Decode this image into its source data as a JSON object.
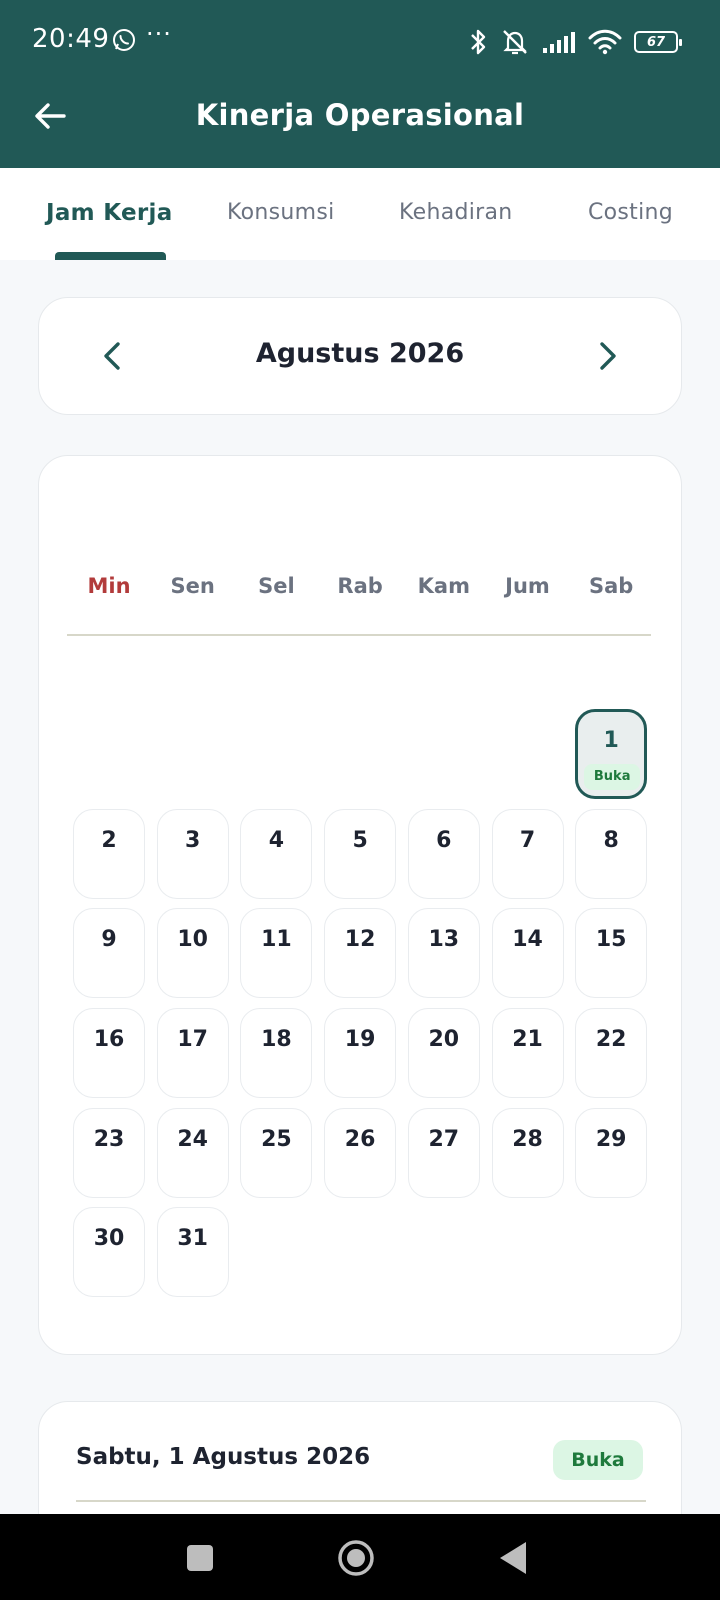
{
  "status_bar": {
    "time": "20:49",
    "more": "···",
    "battery": "67",
    "icons": [
      "whatsapp-icon",
      "bluetooth-icon",
      "alarm-off-icon",
      "signal-icon",
      "wifi-icon",
      "battery-icon"
    ]
  },
  "app_bar": {
    "title": "Kinerja Operasional",
    "back_icon": "arrow-left-icon",
    "background": "#215956"
  },
  "tabs": [
    {
      "label": "Jam Kerja",
      "active": true
    },
    {
      "label": "Konsumsi",
      "active": false
    },
    {
      "label": "Kehadiran",
      "active": false
    },
    {
      "label": "Costing",
      "active": false
    }
  ],
  "month_nav": {
    "title": "Agustus 2026",
    "prev_icon": "chevron-left-icon",
    "next_icon": "chevron-right-icon"
  },
  "calendar": {
    "weekdays": [
      "Min",
      "Sen",
      "Sel",
      "Rab",
      "Kam",
      "Jum",
      "Sab"
    ],
    "days": [
      "1",
      "2",
      "3",
      "4",
      "5",
      "6",
      "7",
      "8",
      "9",
      "10",
      "11",
      "12",
      "13",
      "14",
      "15",
      "16",
      "17",
      "18",
      "19",
      "20",
      "21",
      "22",
      "23",
      "24",
      "25",
      "26",
      "27",
      "28",
      "29",
      "30",
      "31"
    ],
    "selected_day": "1",
    "selected_tag": "Buka",
    "weekend_color": "#b23b3b"
  },
  "detail": {
    "date": "Sabtu, 1 Agustus 2026",
    "status": "Buka",
    "status_color": "#1e7a3c"
  },
  "system_nav": {
    "icons": [
      "recents-icon",
      "home-icon",
      "back-icon"
    ]
  }
}
